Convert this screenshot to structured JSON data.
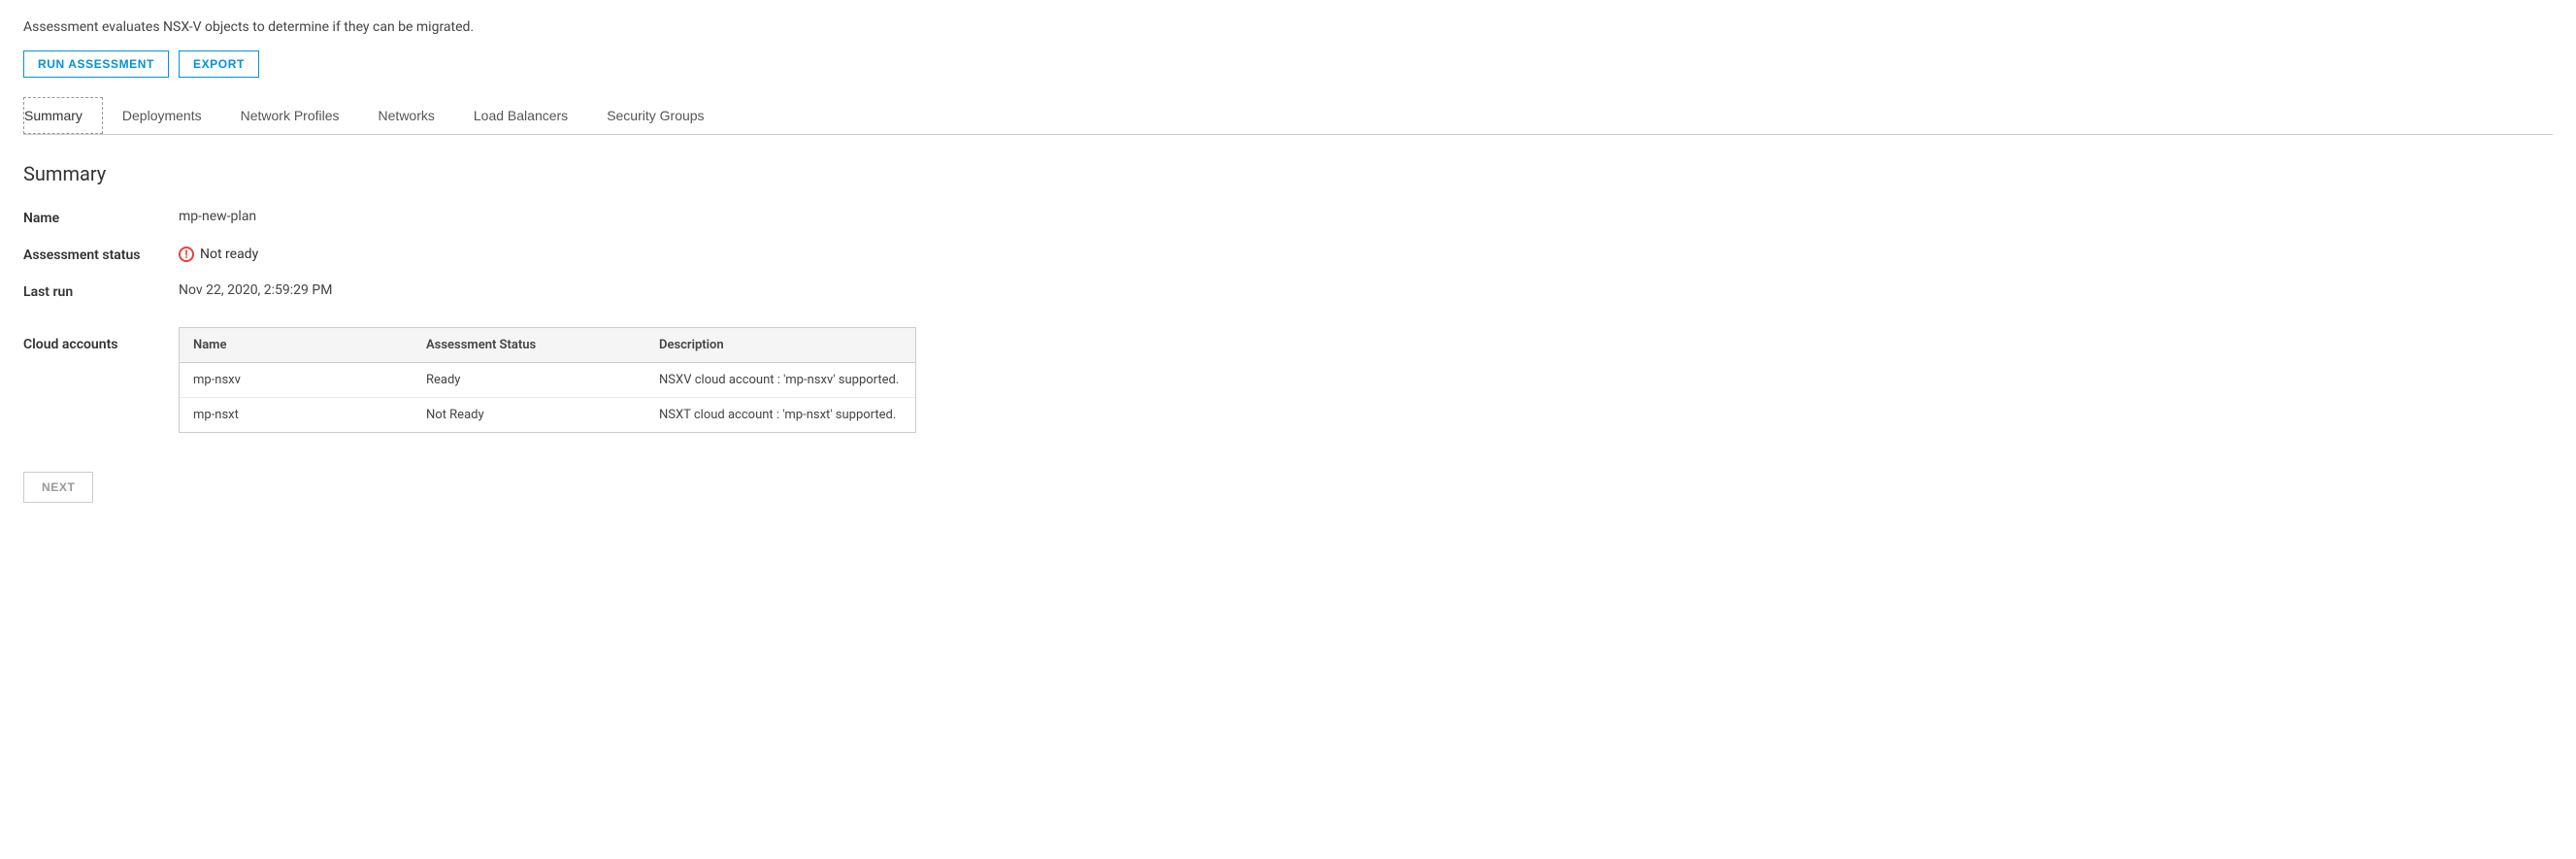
{
  "description": "Assessment evaluates NSX-V objects to determine if they can be migrated.",
  "toolbar": {
    "run_assessment_label": "RUN ASSESSMENT",
    "export_label": "EXPORT"
  },
  "tabs": [
    {
      "id": "summary",
      "label": "Summary",
      "active": true
    },
    {
      "id": "deployments",
      "label": "Deployments",
      "active": false
    },
    {
      "id": "network-profiles",
      "label": "Network Profiles",
      "active": false
    },
    {
      "id": "networks",
      "label": "Networks",
      "active": false
    },
    {
      "id": "load-balancers",
      "label": "Load Balancers",
      "active": false
    },
    {
      "id": "security-groups",
      "label": "Security Groups",
      "active": false
    }
  ],
  "summary": {
    "title": "Summary",
    "name_label": "Name",
    "name_value": "mp-new-plan",
    "assessment_status_label": "Assessment status",
    "assessment_status_value": "Not ready",
    "last_run_label": "Last run",
    "last_run_value": "Nov 22, 2020, 2:59:29 PM",
    "cloud_accounts_label": "Cloud accounts",
    "table": {
      "columns": [
        {
          "id": "name",
          "label": "Name"
        },
        {
          "id": "status",
          "label": "Assessment Status"
        },
        {
          "id": "description",
          "label": "Description"
        }
      ],
      "rows": [
        {
          "name": "mp-nsxv",
          "status": "Ready",
          "description": "NSXV cloud account : 'mp-nsxv' supported."
        },
        {
          "name": "mp-nsxt",
          "status": "Not Ready",
          "description": "NSXT cloud account : 'mp-nsxt' supported."
        }
      ]
    }
  },
  "next_button_label": "NEXT"
}
